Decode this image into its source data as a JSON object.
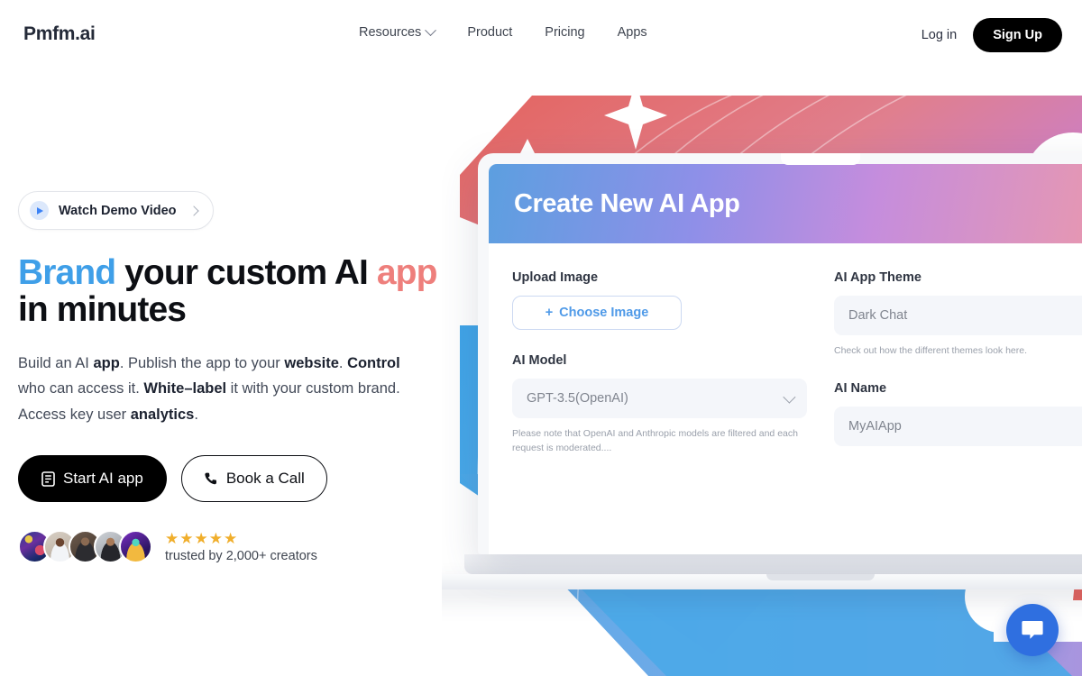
{
  "nav": {
    "logo": "Pmfm.ai",
    "links": [
      {
        "label": "Resources",
        "has_chevron": true
      },
      {
        "label": "Product",
        "has_chevron": false
      },
      {
        "label": "Pricing",
        "has_chevron": false
      },
      {
        "label": "Apps",
        "has_chevron": false
      }
    ],
    "login_label": "Log in",
    "signup_label": "Sign Up"
  },
  "hero": {
    "demo_pill_label": "Watch Demo Video",
    "headline": {
      "word_brand": "Brand",
      "mid": " your custom AI ",
      "word_app": "app",
      "line2": "in minutes"
    },
    "subcopy": {
      "p1a": "Build an AI ",
      "b1": "app",
      "p1b": ". Publish the app to your ",
      "b2": "website",
      "p1c": ". ",
      "b3": "Control",
      "p2a": " who can access it. ",
      "b4": "White–label",
      "p2b": " it with your custom brand. Access key user ",
      "b5": "analytics",
      "p2c": "."
    },
    "primary_cta": "Start AI app",
    "secondary_cta": "Book a Call",
    "stars": "★★★★★",
    "star_count": 5,
    "trusted_text": "trusted by 2,000+ creators",
    "avatar_count": 5
  },
  "mockup": {
    "app_title": "Create New AI App",
    "fields": {
      "upload_image_label": "Upload Image",
      "choose_image_label": "Choose Image",
      "choose_image_plus": "+",
      "ai_model_label": "AI Model",
      "ai_model_value": "GPT-3.5(OpenAI)",
      "ai_model_helper": "Please note that OpenAI and Anthropic models are filtered and each request is moderated....",
      "ai_app_theme_label": "AI App Theme",
      "ai_app_theme_value": "Dark Chat",
      "ai_app_theme_helper": "Check out how the different themes look here.",
      "ai_name_label": "AI Name",
      "ai_name_value": "MyAIApp"
    }
  },
  "chat_widget": {
    "icon": "chat-bubble-icon"
  },
  "colors": {
    "brand_blue": "#3f9fe8",
    "brand_red": "#ee7f7c",
    "accent_button": "#000000",
    "star_gold": "#f0ae2b",
    "chat_blue": "#2f6fe0",
    "link_blue": "#4f9ae8"
  }
}
